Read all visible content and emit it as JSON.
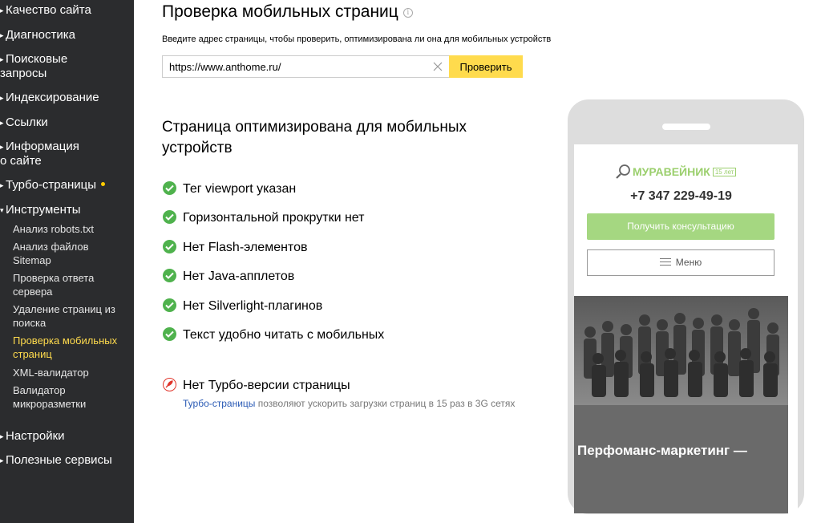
{
  "sidebar": {
    "items": [
      {
        "label": "Качество сайта"
      },
      {
        "label": "Диагностика"
      },
      {
        "label": "Поисковые запросы"
      },
      {
        "label": "Индексирование"
      },
      {
        "label": "Ссылки"
      },
      {
        "label": "Информация о сайте"
      },
      {
        "label": "Турбо-страницы"
      },
      {
        "label": "Инструменты"
      },
      {
        "label": "Настройки"
      },
      {
        "label": "Полезные сервисы"
      }
    ],
    "tools": [
      {
        "label": "Анализ robots.txt"
      },
      {
        "label": "Анализ файлов Sitemap"
      },
      {
        "label": "Проверка ответа сервера"
      },
      {
        "label": "Удаление страниц из поиска"
      },
      {
        "label": "Проверка мобильных страниц",
        "active": true
      },
      {
        "label": "XML-валидатор"
      },
      {
        "label": "Валидатор микроразметки"
      }
    ]
  },
  "main": {
    "title": "Проверка мобильных страниц",
    "hint": "Введите адрес страницы, чтобы проверить, оптимизирована ли она для мобильных устройств",
    "url_value": "https://www.anthome.ru/",
    "check_button": "Проверить",
    "result_title": "Страница оптимизирована для мобильных устройств",
    "checks": [
      "Тег viewport указан",
      "Горизонтальной прокрутки нет",
      "Нет Flash-элементов",
      "Нет Java-апплетов",
      "Нет Silverlight-плагинов",
      "Текст удобно читать с мобильных"
    ],
    "turbo": {
      "title": "Нет Турбо-версии страницы",
      "link": "Турбо-страницы",
      "desc": " позволяют ускорить загрузки страниц в 15 раз в 3G сетях"
    }
  },
  "preview": {
    "logo": "МУРАВЕЙНИК",
    "logo_badge": "15 лет",
    "phone": "+7 347 229-49-19",
    "consult_button": "Получить консультацию",
    "menu_button": "Меню",
    "photo_caption": "Перфоманс-маркетинг —"
  },
  "colors": {
    "sidebar_bg": "#2b2c2e",
    "accent_yellow": "#ffdb4d",
    "success_green": "#4fb24d",
    "error_red": "#e0352b",
    "link_blue": "#2b5bb5"
  }
}
